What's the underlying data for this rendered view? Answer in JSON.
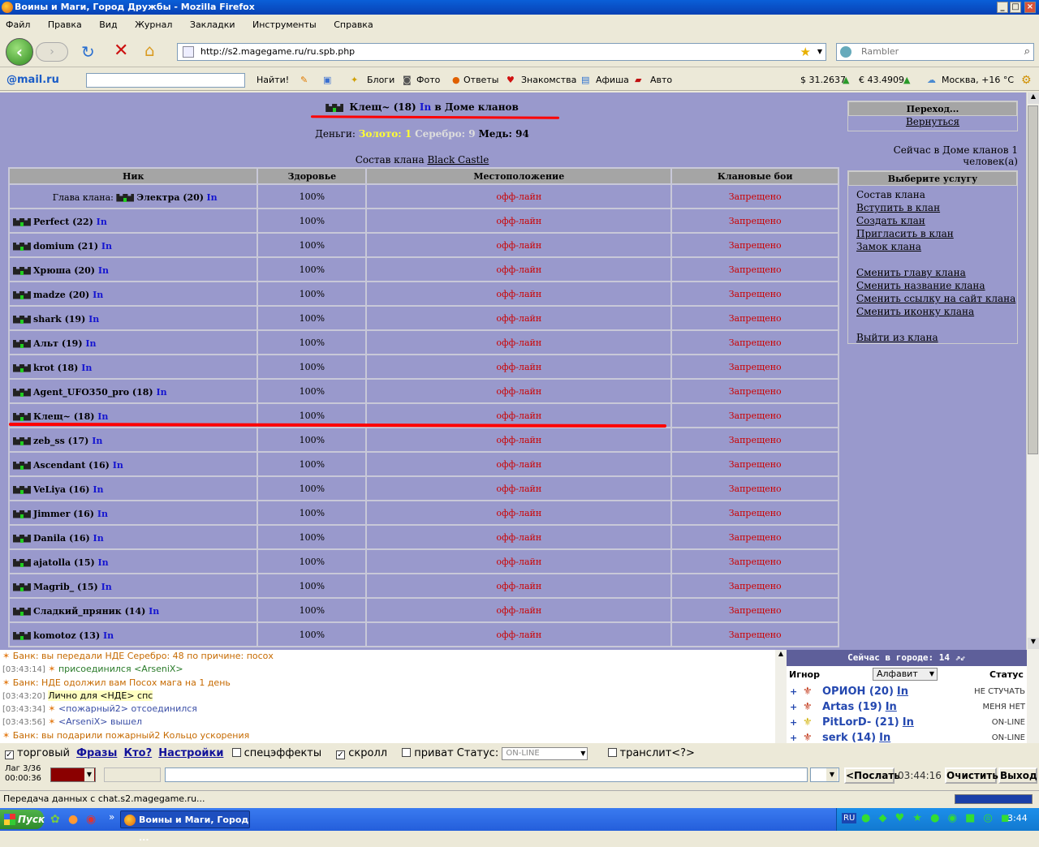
{
  "window": {
    "title": "Воины и Маги, Город Дружбы - Mozilla Firefox"
  },
  "menu": [
    "Файл",
    "Правка",
    "Вид",
    "Журнал",
    "Закладки",
    "Инструменты",
    "Справка"
  ],
  "nav": {
    "url": "http://s2.magegame.ru/ru.spb.php",
    "search_placeholder": "Rambler"
  },
  "mailbar": {
    "logo": "@mail.ru",
    "find": "Найти!",
    "links": [
      "Блоги",
      "Фото",
      "Ответы",
      "Знакомства",
      "Афиша",
      "Авто"
    ],
    "usd": "$ 31.2637",
    "eur": "€ 43.4909",
    "weather": "Москва, +16 °C"
  },
  "header": {
    "name": "Клещ~ (18)",
    "in": "In",
    "location": "в Доме кланов",
    "money_label": "Деньги:",
    "gold": "Золото: 1",
    "silver": "Серебро: 9",
    "copper": "Медь: 94",
    "clan_label": "Состав клана",
    "clan_name": "Black Castle"
  },
  "table": {
    "headers": [
      "Ник",
      "Здоровье",
      "Местоположение",
      "Клановые бои"
    ],
    "head_label": "Глава клана:",
    "rows": [
      {
        "nick": "Электра (20)",
        "health": "100%",
        "loc": "офф-лайн",
        "fight": "Запрещено"
      },
      {
        "nick": "Perfect (22)",
        "health": "100%",
        "loc": "офф-лайн",
        "fight": "Запрещено"
      },
      {
        "nick": "domium (21)",
        "health": "100%",
        "loc": "офф-лайн",
        "fight": "Запрещено"
      },
      {
        "nick": "Хрюша (20)",
        "health": "100%",
        "loc": "офф-лайн",
        "fight": "Запрещено"
      },
      {
        "nick": "madze (20)",
        "health": "100%",
        "loc": "офф-лайн",
        "fight": "Запрещено"
      },
      {
        "nick": "shark (19)",
        "health": "100%",
        "loc": "офф-лайн",
        "fight": "Запрещено"
      },
      {
        "nick": "Альт (19)",
        "health": "100%",
        "loc": "офф-лайн",
        "fight": "Запрещено"
      },
      {
        "nick": "krot (18)",
        "health": "100%",
        "loc": "офф-лайн",
        "fight": "Запрещено"
      },
      {
        "nick": "Agent_UFO350_pro (18)",
        "health": "100%",
        "loc": "офф-лайн",
        "fight": "Запрещено"
      },
      {
        "nick": "Клещ~ (18)",
        "health": "100%",
        "loc": "офф-лайн",
        "fight": "Запрещено"
      },
      {
        "nick": "zeb_ss (17)",
        "health": "100%",
        "loc": "офф-лайн",
        "fight": "Запрещено"
      },
      {
        "nick": "Ascendant (16)",
        "health": "100%",
        "loc": "офф-лайн",
        "fight": "Запрещено"
      },
      {
        "nick": "VeLiya (16)",
        "health": "100%",
        "loc": "офф-лайн",
        "fight": "Запрещено"
      },
      {
        "nick": "Jimmer (16)",
        "health": "100%",
        "loc": "офф-лайн",
        "fight": "Запрещено"
      },
      {
        "nick": "Danila (16)",
        "health": "100%",
        "loc": "офф-лайн",
        "fight": "Запрещено"
      },
      {
        "nick": "ajatolla (15)",
        "health": "100%",
        "loc": "офф-лайн",
        "fight": "Запрещено"
      },
      {
        "nick": "Magrib_ (15)",
        "health": "100%",
        "loc": "офф-лайн",
        "fight": "Запрещено"
      },
      {
        "nick": "Сладкий_пряник (14)",
        "health": "100%",
        "loc": "офф-лайн",
        "fight": "Запрещено"
      },
      {
        "nick": "komotoz (13)",
        "health": "100%",
        "loc": "офф-лайн",
        "fight": "Запрещено"
      }
    ]
  },
  "goto": {
    "title": "Переход...",
    "back": "Вернуться"
  },
  "house_count": "Сейчас в Доме кланов 1 человек(а)",
  "services": {
    "title": "Выберите услугу",
    "items": [
      "Состав клана",
      "Вступить в клан",
      "Создать клан",
      "Пригласить в клан",
      "Замок клана",
      "",
      "Сменить главу клана",
      "Сменить название клана",
      "Сменить ссылку на сайт клана",
      "Сменить иконку клана",
      "",
      "Выйти из клана"
    ]
  },
  "chat": [
    {
      "ts": "",
      "text": "Банк: вы передали НДЕ Серебро: 48 по причине: посох",
      "cls": "bank"
    },
    {
      "ts": "[03:43:14]",
      "text": "присоединился <ArseniX>",
      "cls": "grn"
    },
    {
      "ts": "",
      "text": "Банк: НДЕ одолжил вам Посох мага на 1 день",
      "cls": "bank"
    },
    {
      "ts": "[03:43:20]",
      "text": "Лично для <НДЕ> спс",
      "cls": "priv"
    },
    {
      "ts": "[03:43:34]",
      "text": "<пожарный2> отсоединился",
      "cls": "blu"
    },
    {
      "ts": "[03:43:56]",
      "text": "<ArseniX> вышел",
      "cls": "blu"
    },
    {
      "ts": "",
      "text": "Банк: вы подарили пожарный2 Кольцо ускорения",
      "cls": "bank"
    }
  ],
  "online": {
    "title": "Сейчас в городе: 14",
    "ignore": "Игнор",
    "sort": "Алфавит",
    "status": "Статус",
    "users": [
      {
        "name": "ОРИОН (20)",
        "in": "In",
        "status": "НЕ СТУЧАТЬ"
      },
      {
        "name": "Artas (19)",
        "in": "In",
        "status": "МЕНЯ НЕТ"
      },
      {
        "name": "PitLorD- (21)",
        "in": "In",
        "status": "ON-LINE"
      },
      {
        "name": "serk (14)",
        "in": "In",
        "status": "ON-LINE"
      }
    ]
  },
  "controls": {
    "trade": "торговый",
    "phrases": "Фразы",
    "who": "Кто?",
    "settings": "Настройки",
    "effects": "спецэффекты",
    "scroll": "скролл",
    "private": "приват",
    "status_label": "Статус:",
    "status_val": "ON-LINE",
    "translit": "транслит<?>"
  },
  "inputrow": {
    "lag": "Лаг 3/36",
    "timer": "00:00:36",
    "send": "<Послать",
    "clock": "03:44:16",
    "clear": "Очистить",
    "exit": "Выход"
  },
  "statusbar": "Передача данных с chat.s2.magegame.ru...",
  "taskbar": {
    "start": "Пуск",
    "task": "Воины и Маги, Город ...",
    "lang": "RU",
    "time": "3:44"
  },
  "colors": {
    "game_bg": "#9999cc",
    "underline": "#ff0000",
    "header_bar": "#a5a5a5"
  }
}
